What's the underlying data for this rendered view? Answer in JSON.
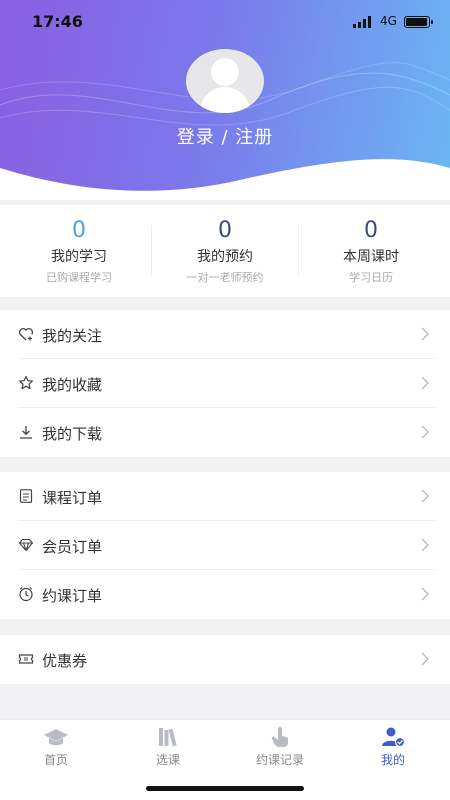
{
  "status_bar": {
    "time": "17:46",
    "network": "4G"
  },
  "profile": {
    "login_label": "登录 / 注册"
  },
  "stats": [
    {
      "value": "0",
      "title": "我的学习",
      "subtitle": "已购课程学习"
    },
    {
      "value": "0",
      "title": "我的预约",
      "subtitle": "一对一老师预约"
    },
    {
      "value": "0",
      "title": "本周课时",
      "subtitle": "学习日历"
    }
  ],
  "menu": {
    "follow": "我的关注",
    "favorites": "我的收藏",
    "downloads": "我的下载",
    "course_orders": "课程订单",
    "member_orders": "会员订单",
    "booking_orders": "约课订单",
    "coupons": "优惠券"
  },
  "tabs": [
    {
      "label": "首页",
      "icon": "graduation-cap-icon"
    },
    {
      "label": "选课",
      "icon": "books-icon"
    },
    {
      "label": "约课记录",
      "icon": "hand-pointer-icon"
    },
    {
      "label": "我的",
      "icon": "user-check-icon"
    }
  ],
  "colors": {
    "accent": "#3d5dc9",
    "stat_value": "#4aa3dc",
    "gradient_start": "#8a5fe0",
    "gradient_end": "#6ab7f3"
  }
}
